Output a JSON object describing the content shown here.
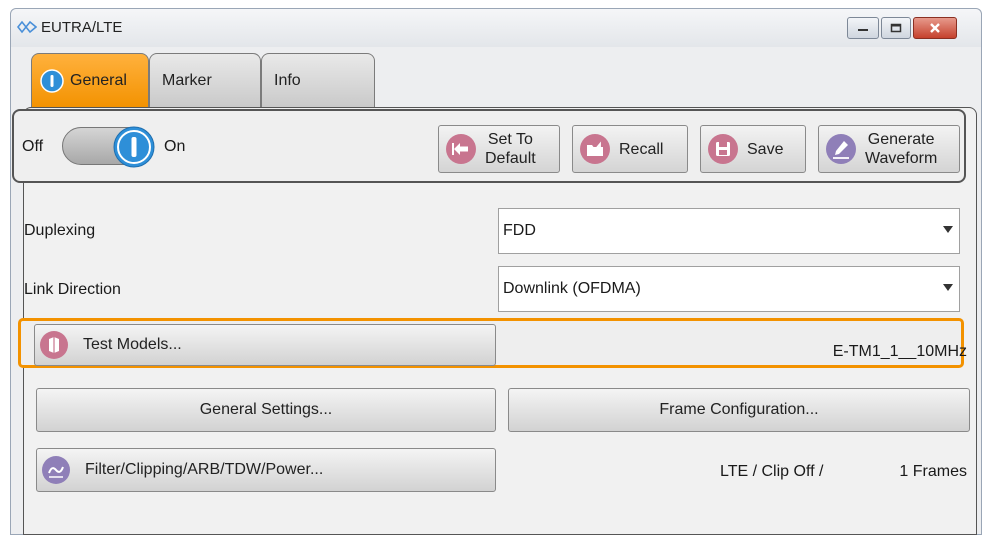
{
  "window": {
    "title": "EUTRA/LTE"
  },
  "tabs": [
    {
      "label": "General"
    },
    {
      "label": "Marker"
    },
    {
      "label": "Info"
    }
  ],
  "toolbar": {
    "off_label": "Off",
    "on_label": "On",
    "state_on": true,
    "set_to_default_label": "Set To\nDefault",
    "recall_label": "Recall",
    "save_label": "Save",
    "generate_waveform_label": "Generate\nWaveform"
  },
  "duplexing": {
    "label": "Duplexing",
    "value": "FDD"
  },
  "link_direction": {
    "label": "Link Direction",
    "value": "Downlink (OFDMA)"
  },
  "test_models": {
    "label": "Test Models...",
    "value": "E-TM1_1__10MHz"
  },
  "general_settings": {
    "label": "General Settings..."
  },
  "frame_configuration": {
    "label": "Frame Configuration..."
  },
  "filter": {
    "label": "Filter/Clipping/ARB/TDW/Power...",
    "status": "LTE / Clip Off /",
    "frames": "1 Frames"
  },
  "colors": {
    "accent_orange": "#f39200",
    "icon_pink": "#c8758f",
    "icon_purple": "#8f7fb8",
    "icon_blue": "#2e8fd8"
  }
}
